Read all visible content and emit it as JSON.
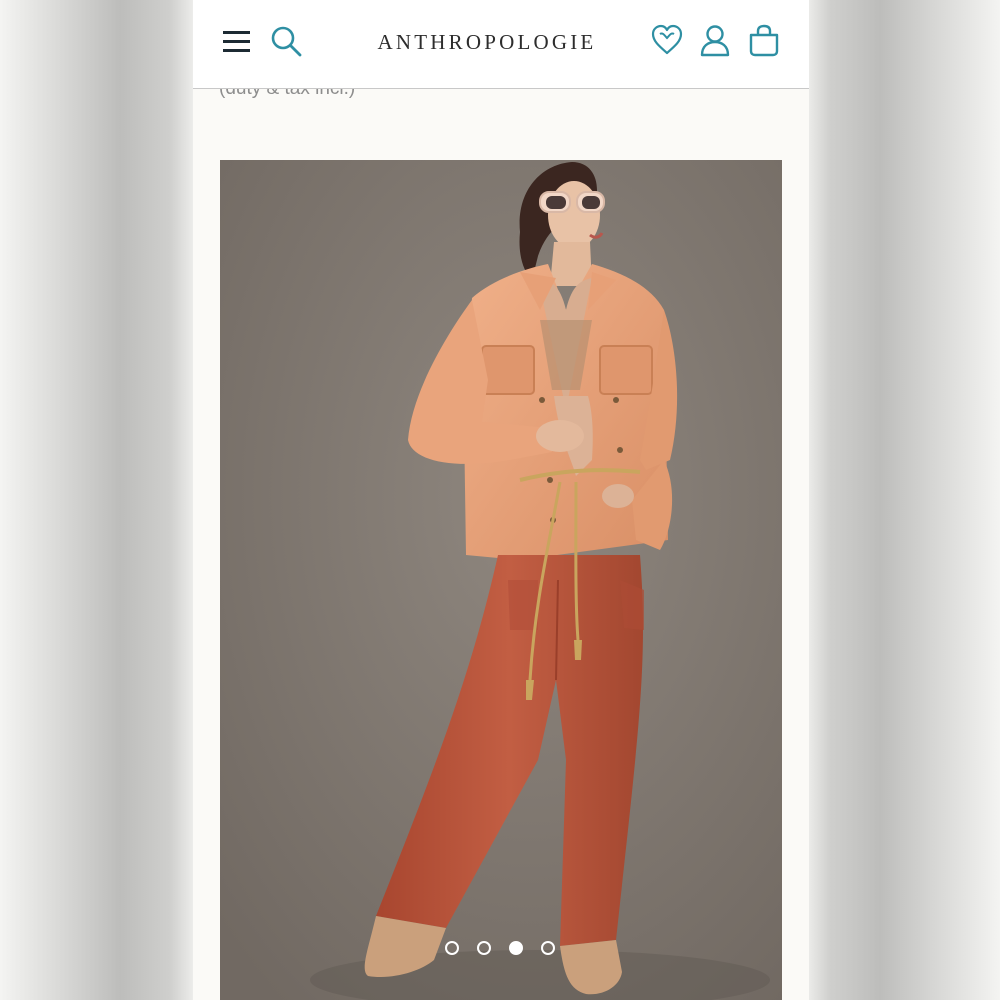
{
  "header": {
    "logo": "ANTHROPOLOGIE",
    "icons": [
      "menu-icon",
      "search-icon",
      "wishlist-heart-icon",
      "account-icon",
      "shopping-bag-icon"
    ]
  },
  "product": {
    "price_note": "(duty & tax incl.)",
    "carousel": {
      "total_slides": 4,
      "active_slide": 3
    }
  },
  "colors": {
    "accent": "#2e8fa3",
    "jacket": "#e9a47c",
    "pants": "#b9563d",
    "backdrop": "#8c837c"
  }
}
